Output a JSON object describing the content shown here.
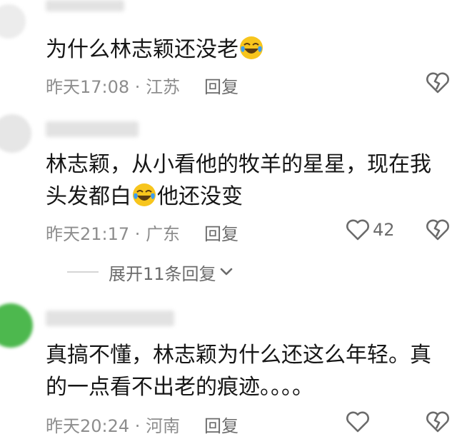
{
  "comments": [
    {
      "text_parts": [
        "为什么林志颖还没老"
      ],
      "time": "昨天17:08",
      "location": "江苏",
      "reply_label": "回复"
    },
    {
      "text_parts": [
        "林志颖，从小看他的牧羊的星星，现在我",
        "头发都白",
        "他还没变"
      ],
      "time": "昨天21:17",
      "location": "广东",
      "reply_label": "回复",
      "likes": "42"
    },
    {
      "text_parts": [
        "真搞不懂，林志颖为什么还这么年轻。真",
        "的一点看不出老的痕迹。。。。"
      ],
      "time": "昨天20:24",
      "location": "河南",
      "reply_label": "回复"
    }
  ],
  "expand_replies": "展开11条回复",
  "meta_separator": " · ",
  "icons": {
    "emoji": "laughing-tears-emoji",
    "like": "heart-outline-icon",
    "dislike": "broken-heart-icon",
    "expand": "chevron-down-icon"
  },
  "colors": {
    "meta": "#8d8d8d",
    "emoji_face": "#f7c51d",
    "avatar_green": "#4db84e"
  }
}
